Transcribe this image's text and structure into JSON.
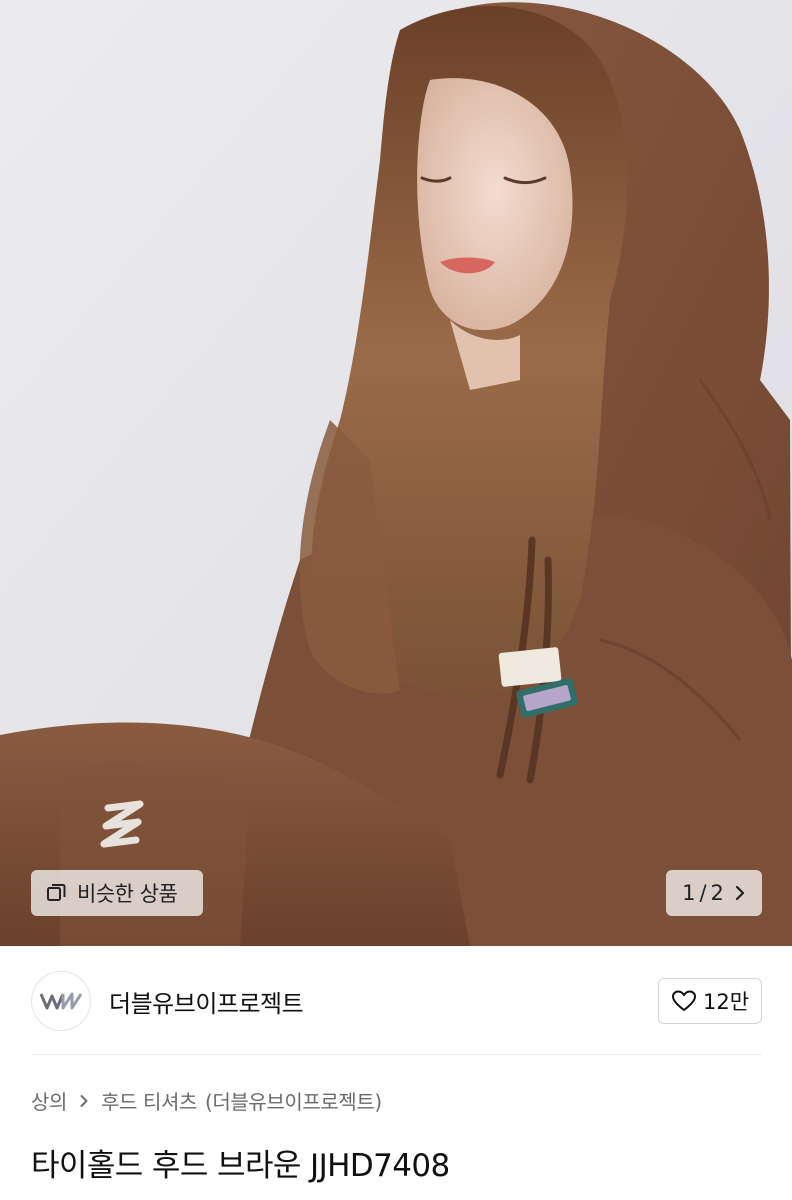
{
  "gallery": {
    "image_alt": "Model wearing brown hooded sweatshirt",
    "similar_label": "비슷한 상품",
    "page_current": "1",
    "page_separator": "/",
    "page_total": "2"
  },
  "brand": {
    "name": "더블유브이프로젝트",
    "likes": "12만"
  },
  "breadcrumb": {
    "category": "상의",
    "subcategory": "후드 티셔츠",
    "brand_suffix": "(더블유브이프로젝트)"
  },
  "product": {
    "title": "타이홀드 후드 브라운 JJHD7408"
  },
  "colors": {
    "background": "#ffffff",
    "photo_bg": "#e6e5ea",
    "hoodie_brown": "#7a4e37",
    "text_primary": "#111111",
    "text_secondary": "#6b6b6b",
    "border": "#d4d4d4"
  }
}
